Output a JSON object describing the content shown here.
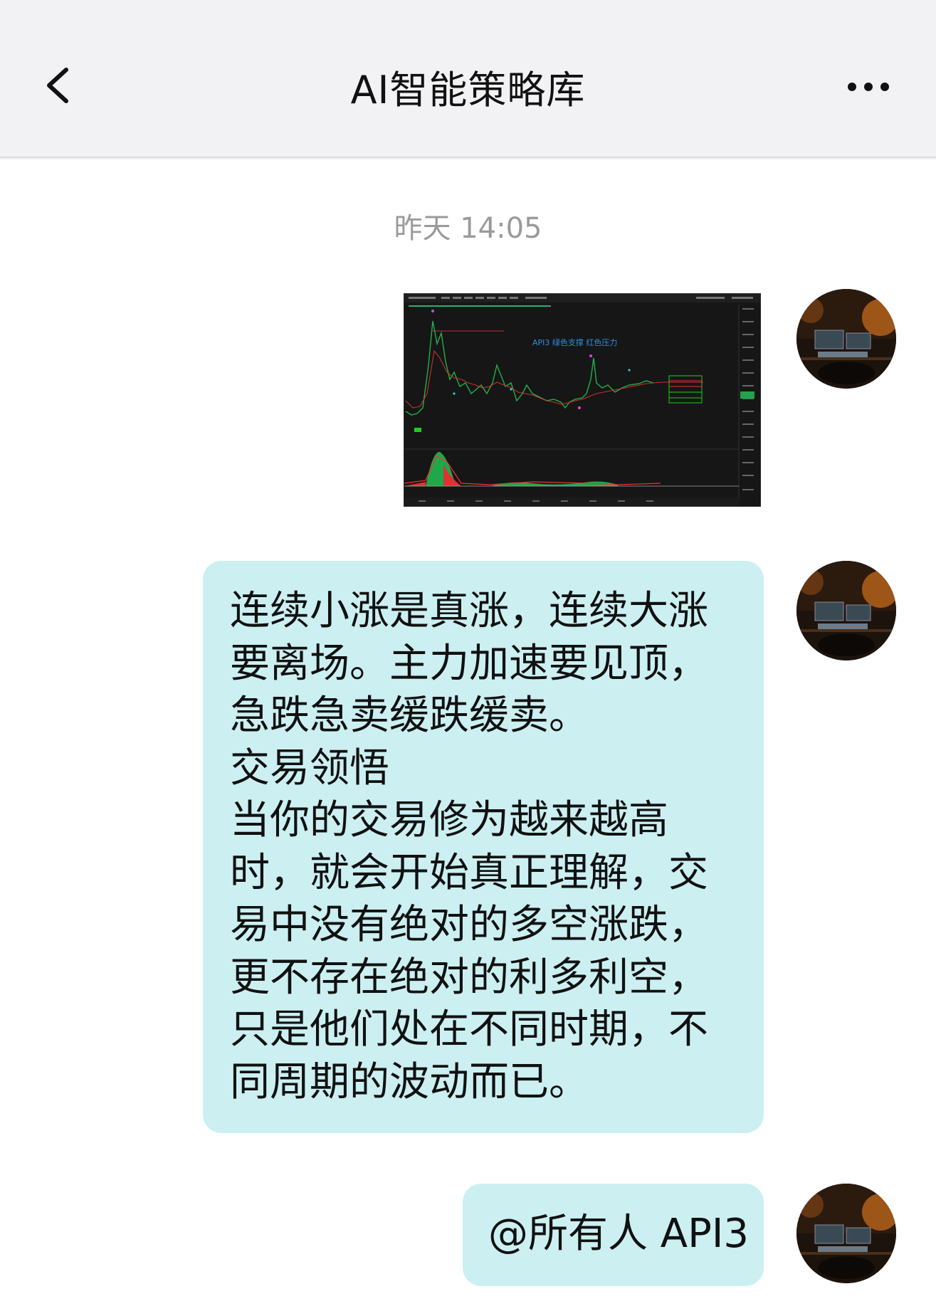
{
  "header": {
    "title": "AI智能策略库",
    "back_icon": "chevron-left-icon",
    "more_icon": "more-dots-icon"
  },
  "chat": {
    "timestamp": "昨天 14:05",
    "messages": [
      {
        "type": "image",
        "chart_caption": "API3  绿色支撑  红色压力"
      },
      {
        "type": "text",
        "text": "连续小涨是真涨，连续大涨要离场。主力加速要见顶，急跌急卖缓跌缓卖。\n交易领悟\n当你的交易修为越来越高时，就会开始真正理解，交易中没有绝对的多空涨跌，更不存在绝对的利多利空，只是他们处在不同时期，不同周期的波动而已。"
      },
      {
        "type": "text",
        "text": "@所有人 API3"
      }
    ]
  },
  "colors": {
    "header_bg": "#f2f2f4",
    "bubble_bg": "#ccf0f2",
    "timestamp": "#9a9a9a",
    "chart_up": "#22c55e",
    "chart_down": "#e53935"
  }
}
